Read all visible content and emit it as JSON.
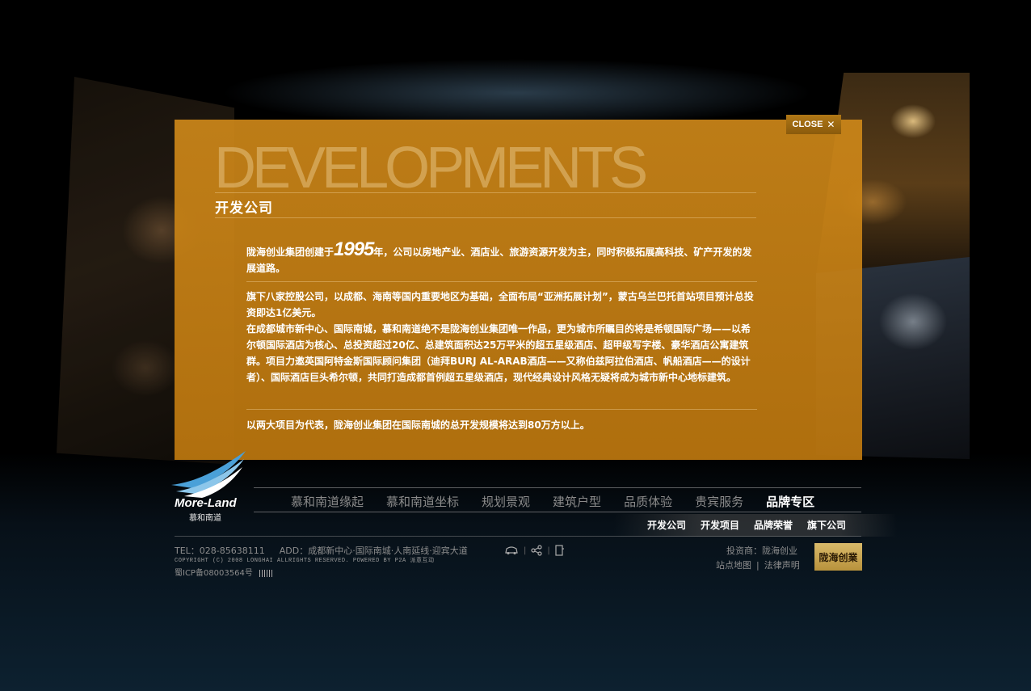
{
  "close": {
    "label": "CLOSE",
    "icon": "close-icon"
  },
  "content": {
    "big_title": "DEVELOPMENTS",
    "sub_title": "开发公司",
    "p1_pre": "陇海创业集团创建于",
    "p1_year": "1995",
    "p1_post": "年，公司以房地产业、酒店业、旅游资源开发为主，同时积极拓展高科技、矿产开发的发展道路。",
    "p2": "旗下八家控股公司，以成都、海南等国内重要地区为基础，全面布局“亚洲拓展计划”，蒙古乌兰巴托首站项目预计总投资即达1亿美元。",
    "p3": "在成都城市新中心、国际南城，慕和南道绝不是陇海创业集团唯一作品，更为城市所瞩目的将是希顿国际广场——以希尔顿国际酒店为核心、总投资超过20亿、总建筑面积达25万平米的超五星级酒店、超甲级写字楼、豪华酒店公寓建筑群。项目力邀英国阿特金斯国际顾问集团（迪拜BURJ AL-ARAB酒店——又称伯兹阿拉伯酒店、帆船酒店——的设计者）、国际酒店巨头希尔顿，共同打造成都首例超五星级酒店，现代经典设计风格无疑将成为城市新中心地标建筑。",
    "p4": "以两大项目为代表，陇海创业集团在国际南城的总开发规模将达到80万方以上。"
  },
  "logo": {
    "text": "More-Land",
    "cn": "慕和南道"
  },
  "nav": {
    "main": [
      "慕和南道缘起",
      "慕和南道坐标",
      "规划景观",
      "建筑户型",
      "品质体验",
      "贵宾服务",
      "品牌专区"
    ],
    "active_index": 6,
    "sub": [
      "开发公司",
      "开发项目",
      "品牌荣誉",
      "旗下公司"
    ]
  },
  "footer": {
    "tel": "TEL：028-85638111",
    "addr": "ADD：成都新中心·国际南城·人南延线·迎宾大道",
    "copyright": "COPYRIGHT (C) 2008 LONGHAI ALLRIGHTS RESERVED. POWERED BY P2A 派意互动",
    "icp": "蜀ICP备08003564号",
    "investor": "投资商：陇海创业",
    "sitemap": "站点地图",
    "legal": "法律声明",
    "separator": "|",
    "badge": "陇海创業",
    "icons": [
      "car-icon",
      "share-icon",
      "bookmark-icon"
    ]
  },
  "colors": {
    "panel": "#c8861a",
    "accent": "#b07816",
    "background": "#000000"
  }
}
